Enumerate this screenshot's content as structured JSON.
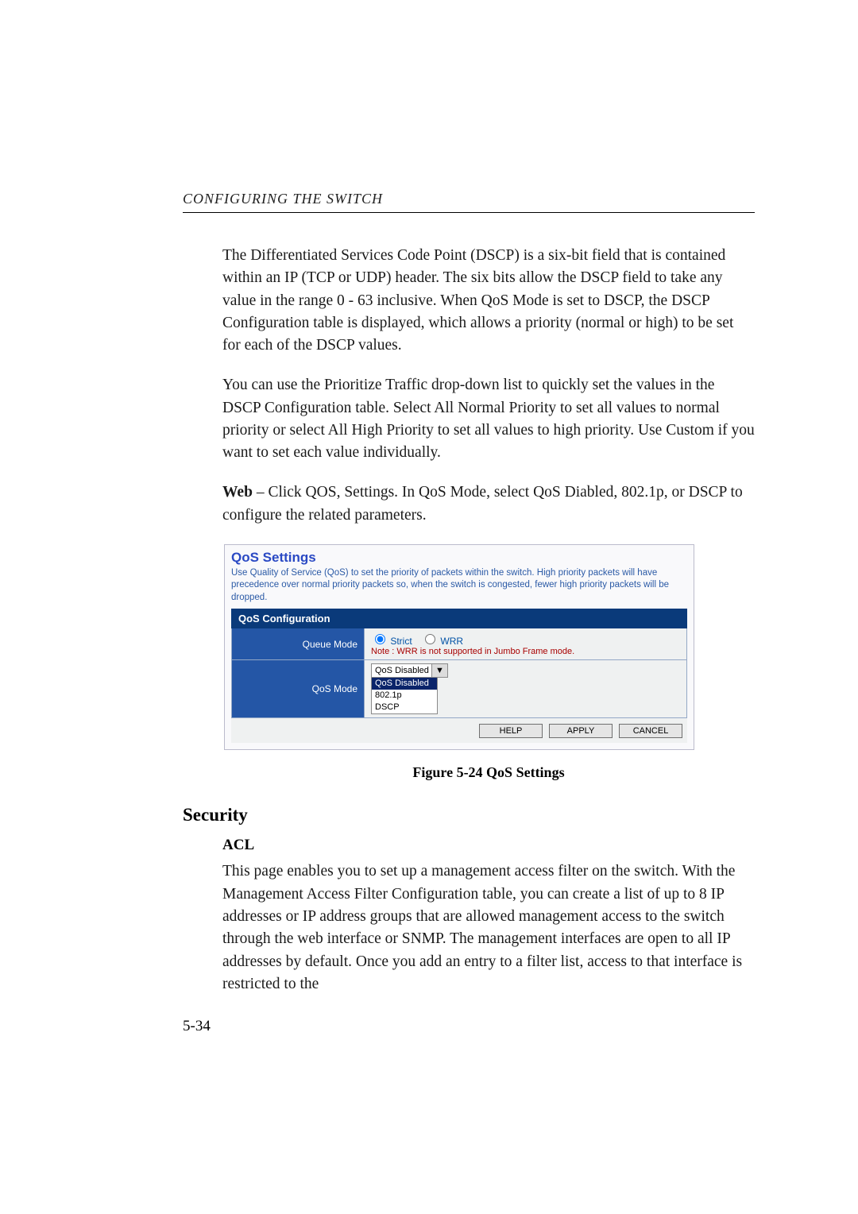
{
  "header": {
    "running_head": "CONFIGURING THE SWITCH"
  },
  "paragraphs": {
    "p1": "The Differentiated Services Code Point (DSCP) is a six-bit field that is contained within an IP (TCP or UDP) header. The six bits allow the DSCP field to take any value in the range 0 - 63 inclusive. When QoS Mode is set to DSCP, the DSCP Configuration table is displayed, which allows a priority (normal or high) to be set for each of the DSCP values.",
    "p2": "You can use the Prioritize Traffic drop-down list to quickly set the values in the DSCP Configuration table. Select All Normal Priority to set all values to normal priority or select All High Priority to set all values to high priority. Use Custom if you want to set each value individually.",
    "p3_lead": "Web",
    "p3_rest": " – Click QOS, Settings. In QoS Mode, select QoS Diabled, 802.1p, or DSCP to configure the related parameters."
  },
  "screenshot": {
    "title": "QoS Settings",
    "description": "Use Quality of Service (QoS) to set the priority of packets within the switch. High priority packets will have precedence over normal priority packets so, when the switch is congested, fewer high priority packets will be dropped.",
    "section_header": "QoS Configuration",
    "rows": {
      "queue_mode_label": "Queue Mode",
      "strict_label": "Strict",
      "wrr_label": "WRR",
      "strict_checked": true,
      "wrr_checked": false,
      "note": "Note : WRR is not supported in Jumbo Frame mode.",
      "qos_mode_label": "QoS Mode",
      "select_value": "QoS Disabled",
      "options": [
        "QoS Disabled",
        "802.1p",
        "DSCP"
      ]
    },
    "buttons": {
      "help": "HELP",
      "apply": "APPLY",
      "cancel": "CANCEL"
    }
  },
  "figure_caption": "Figure 5-24  QoS Settings",
  "section": {
    "h2": "Security",
    "h3": "ACL",
    "p": "This page enables you to set up a management access filter on the switch. With the Management Access Filter Configuration table, you can create a list of up to 8 IP addresses or IP address groups that are allowed management access to the switch through the web interface or SNMP. The management interfaces are open to all IP addresses by default. Once you add an entry to a filter list, access to that interface is restricted to the"
  },
  "page_number": "5-34"
}
